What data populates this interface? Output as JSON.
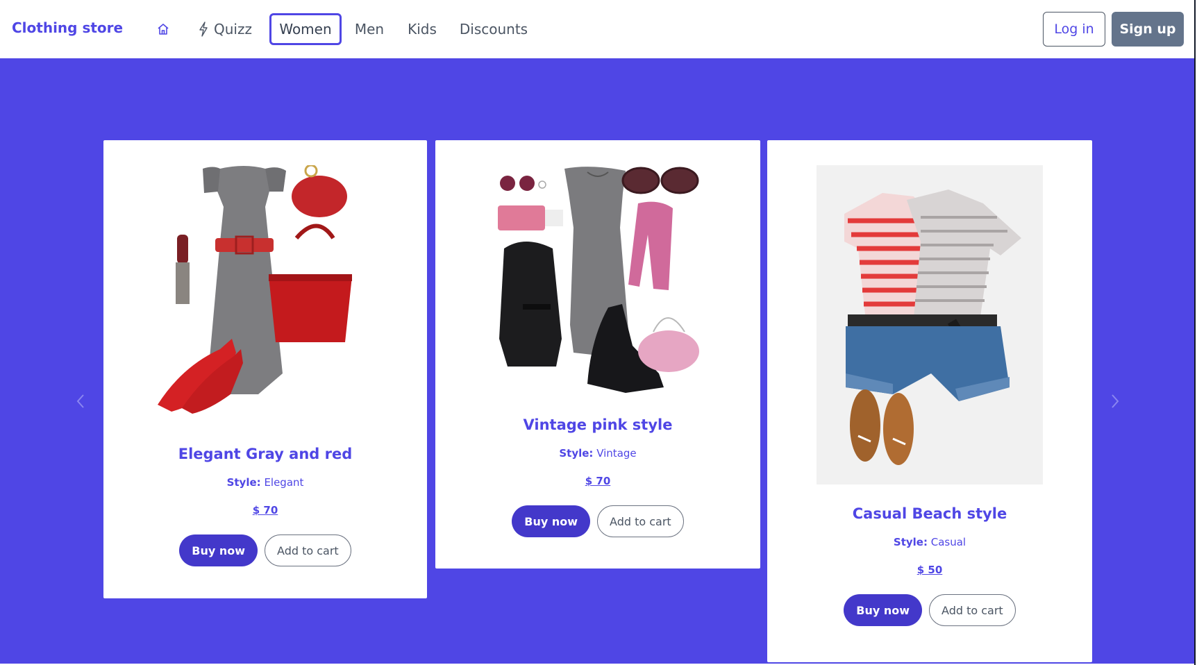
{
  "header": {
    "brand": "Clothing store",
    "nav": {
      "home_icon": "home-icon",
      "quizz_icon": "lightning-icon",
      "quizz": "Quizz",
      "women": "Women",
      "men": "Men",
      "kids": "Kids",
      "discounts": "Discounts"
    },
    "login": "Log in",
    "signup": "Sign up"
  },
  "colors": {
    "accent": "#4f46e5",
    "buy_button": "#4338ca",
    "signup_button": "#64748b",
    "hero_background": "#4f46e5"
  },
  "carousel": {
    "prev_icon": "chevron-left-icon",
    "next_icon": "chevron-right-icon",
    "indicator_count": 2,
    "cards": [
      {
        "title": "Elegant Gray and red",
        "style_label": "Style:",
        "style_value": "Elegant",
        "price": "$ 70",
        "buy": "Buy now",
        "add": "Add to cart"
      },
      {
        "title": "Vintage pink style",
        "style_label": "Style:",
        "style_value": "Vintage",
        "price": "$ 70",
        "buy": "Buy now",
        "add": "Add to cart"
      },
      {
        "title": "Casual Beach style",
        "style_label": "Style:",
        "style_value": "Casual",
        "price": "$ 50",
        "buy": "Buy now",
        "add": "Add to cart"
      }
    ]
  }
}
